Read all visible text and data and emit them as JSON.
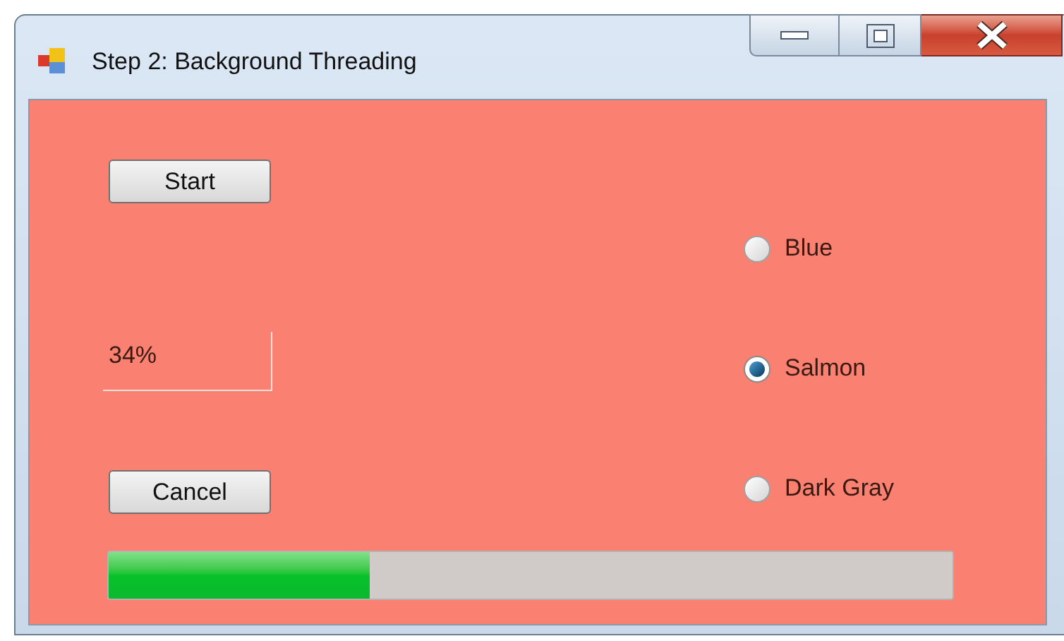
{
  "window": {
    "title": "Step 2: Background Threading"
  },
  "buttons": [
    {
      "label": "Start"
    },
    {
      "label": "Cancel"
    }
  ],
  "progress_label": "34%",
  "radios": [
    {
      "label": "Blue",
      "selected": false
    },
    {
      "label": "Salmon",
      "selected": true
    },
    {
      "label": "Dark Gray",
      "selected": false
    }
  ],
  "progress": {
    "level": 0.31
  }
}
